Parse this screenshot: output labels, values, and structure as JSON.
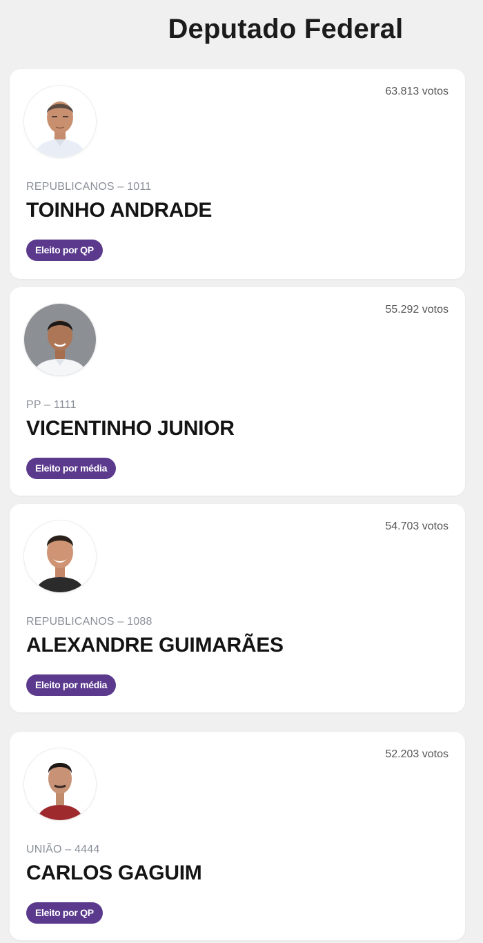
{
  "page": {
    "title": "Deputado Federal"
  },
  "colors": {
    "badge": "#5b3a8e",
    "background": "#f0f0f0"
  },
  "candidates": [
    {
      "votes": "63.813 votos",
      "party": "REPUBLICANOS – 1011",
      "name": "TOINHO ANDRADE",
      "status": "Eleito por QP"
    },
    {
      "votes": "55.292 votos",
      "party": "PP – 1111",
      "name": "VICENTINHO JUNIOR",
      "status": "Eleito por média"
    },
    {
      "votes": "54.703 votos",
      "party": "REPUBLICANOS – 1088",
      "name": "ALEXANDRE GUIMARÃES",
      "status": "Eleito por média"
    },
    {
      "votes": "52.203 votos",
      "party": "UNIÃO – 4444",
      "name": "CARLOS GAGUIM",
      "status": "Eleito por QP"
    }
  ]
}
